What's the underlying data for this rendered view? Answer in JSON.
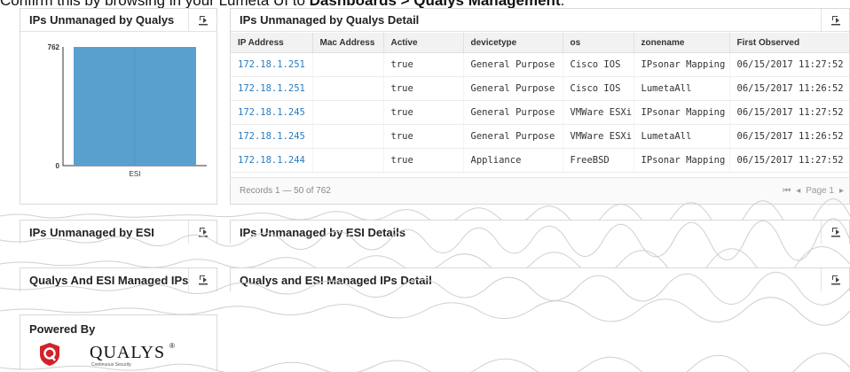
{
  "intro": {
    "prefix": "Confirm this by browsing in your Lumeta UI to ",
    "path": "Dashboards > Qualys Management",
    "suffix": "."
  },
  "panels": {
    "qualys_unmanaged": {
      "title": "IPs Unmanaged by Qualys",
      "export_icon": "export-icon"
    },
    "qualys_unmanaged_detail": {
      "title": "IPs Unmanaged by Qualys Detail",
      "export_icon": "export-icon"
    },
    "esi_unmanaged": {
      "title": "IPs Unmanaged by ESI"
    },
    "esi_unmanaged_detail": {
      "title": "IPs Unmanaged by ESI Details"
    },
    "managed": {
      "title": "Qualys And ESI Managed IPs"
    },
    "managed_detail": {
      "title": "Qualys and ESI Managed IPs Detail"
    }
  },
  "chart_data": {
    "type": "bar",
    "categories": [
      "ESI"
    ],
    "values": [
      762
    ],
    "ylim": [
      0,
      762
    ],
    "ytick_labels": [
      "0",
      "762"
    ],
    "grid": false,
    "bar_color": "#5aa0cf"
  },
  "table": {
    "columns": [
      "IP Address",
      "Mac Address",
      "Active",
      "devicetype",
      "os",
      "zonename",
      "First Observed"
    ],
    "rows": [
      [
        "172.18.1.251",
        "",
        "true",
        "General Purpose",
        "Cisco IOS",
        "IPsonar Mapping",
        "06/15/2017 11:27:52"
      ],
      [
        "172.18.1.251",
        "",
        "true",
        "General Purpose",
        "Cisco IOS",
        "LumetaAll",
        "06/15/2017 11:26:52"
      ],
      [
        "172.18.1.245",
        "",
        "true",
        "General Purpose",
        "VMWare ESXi",
        "IPsonar Mapping",
        "06/15/2017 11:27:52"
      ],
      [
        "172.18.1.245",
        "",
        "true",
        "General Purpose",
        "VMWare ESXi",
        "LumetaAll",
        "06/15/2017 11:26:52"
      ],
      [
        "172.18.1.244",
        "",
        "true",
        "Appliance",
        "FreeBSD",
        "IPsonar Mapping",
        "06/15/2017 11:27:52"
      ]
    ],
    "records_text": "Records 1 — 50 of 762",
    "pager_first": "⏮",
    "pager_prev": "◂",
    "pager_text": "Page 1",
    "pager_next": "▸"
  },
  "powered": {
    "title": "Powered By",
    "logo_text": "QUALYS",
    "logo_reg": "®",
    "logo_sub": "Continuous Security"
  },
  "colors": {
    "link": "#2a7bbf",
    "qualys_red": "#d2232a"
  }
}
